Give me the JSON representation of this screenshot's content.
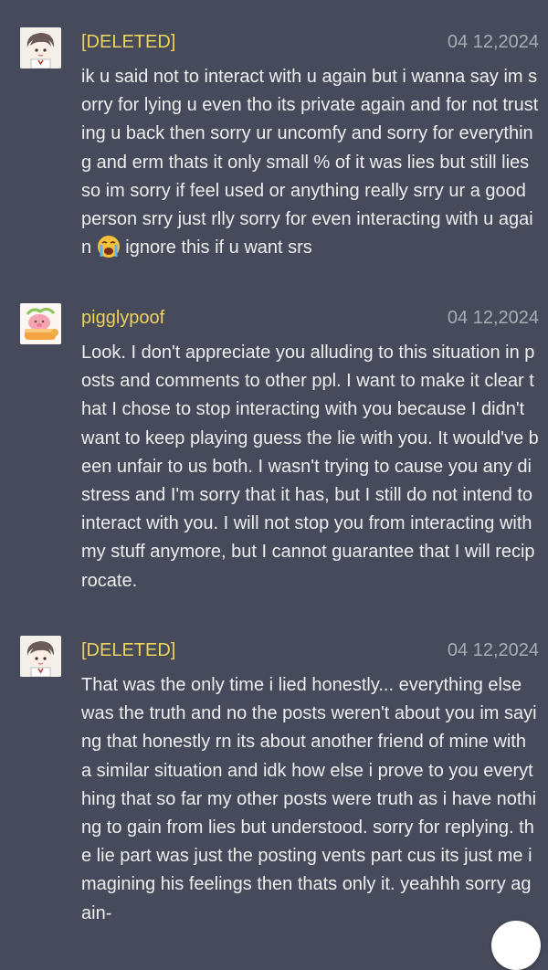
{
  "comments": [
    {
      "username": "[DELETED]",
      "date": "04 12,2024",
      "avatar_icon": "anime-boy-avatar-icon",
      "text_before_emoji": "ik u said not to interact with u again but i wanna say im sorry for lying u even tho its private again and for not trusting u back then sorry ur uncomfy and sorry for everything and erm thats it only small % of it was lies but still lies so im sorry if feel used or anything really srry ur a good person srry just rlly sorry for even interacting with u again",
      "emoji": "loudly-crying-face-icon",
      "text_after_emoji": "ignore this if u want srs"
    },
    {
      "username": "pigglypoof",
      "date": "04 12,2024",
      "avatar_icon": "pig-cake-avatar-icon",
      "text": "Look. I don't appreciate you alluding to this situation in posts and comments to other ppl. I want to make it clear that I chose to stop interacting with you because I didn't want to keep playing guess the lie with you. It would've been unfair to us both. I wasn't trying to cause you any distress and I'm sorry that it has, but I still do not intend to interact with you. I will not stop you from interacting with my stuff anymore, but I cannot guarantee that I will reciprocate."
    },
    {
      "username": "[DELETED]",
      "date": "04 12,2024",
      "avatar_icon": "anime-boy-avatar-icon",
      "text": "That was the only time i lied honestly... everything else was the truth and no the posts weren't about you im saying that honestly rn its about another friend of mine with a similar situation and idk how else i prove to you everything that so far my other posts were truth as i have nothing to gain from lies but understood. sorry for replying. the lie part was just the posting vents part cus its just me imagining his feelings then thats only it. yeahhh sorry again-"
    }
  ],
  "colors": {
    "background": "#464a5b",
    "username": "#ecd45a",
    "date": "#a9abb5",
    "text": "#eeeeef"
  }
}
